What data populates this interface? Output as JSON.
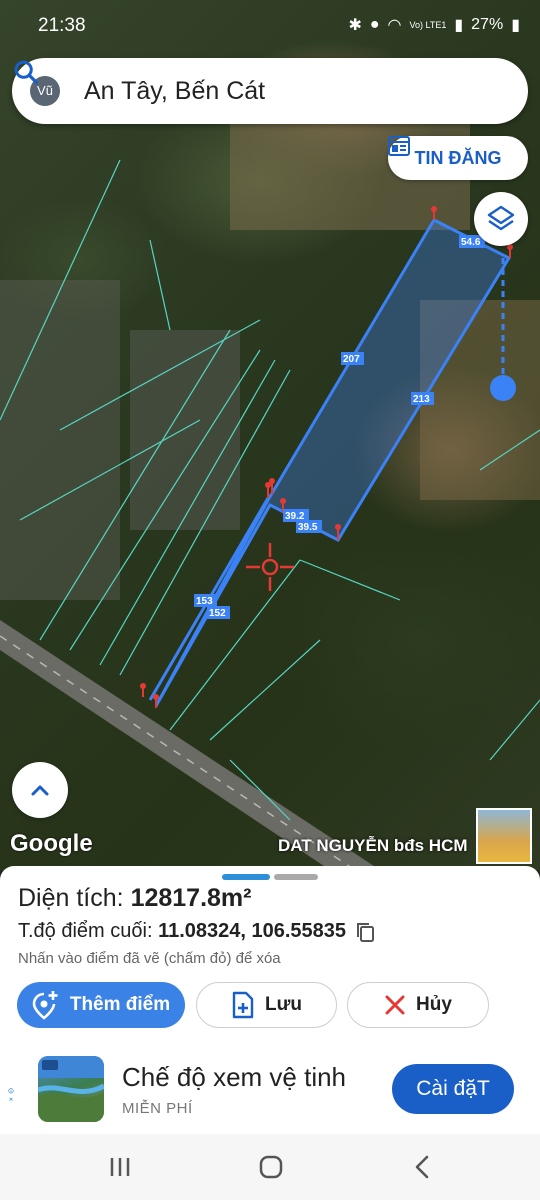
{
  "status_bar": {
    "time": "21:38",
    "signal_text": "Vo) LTE1",
    "battery": "27%"
  },
  "search": {
    "avatar_label": "Vũ",
    "query": "An Tây, Bến Cát"
  },
  "map": {
    "listing_button": "TIN ĐĂNG",
    "edge_labels": [
      "54.6",
      "207",
      "213",
      "39.2",
      "39.5",
      "153",
      "152"
    ],
    "google_logo": "Google",
    "credit": "DAT NGUYỄN bđs HCM"
  },
  "sheet": {
    "area_label": "Diện tích:",
    "area_value": "12817.8m²",
    "coord_label": "T.độ điểm cuối:",
    "coord_value": "11.08324, 106.55835",
    "hint": "Nhấn vào điểm đã vẽ (chấm đỏ) để xóa",
    "add_point": "Thêm điểm",
    "save": "Lưu",
    "cancel": "Hủy"
  },
  "ad": {
    "title": "Chế độ xem vệ tinh",
    "subtitle": "MIỄN PHÍ",
    "install": "Cài đặT"
  },
  "colors": {
    "accent": "#1a5fc8",
    "polygon": "#3b82f6",
    "marker": "#e53935"
  }
}
